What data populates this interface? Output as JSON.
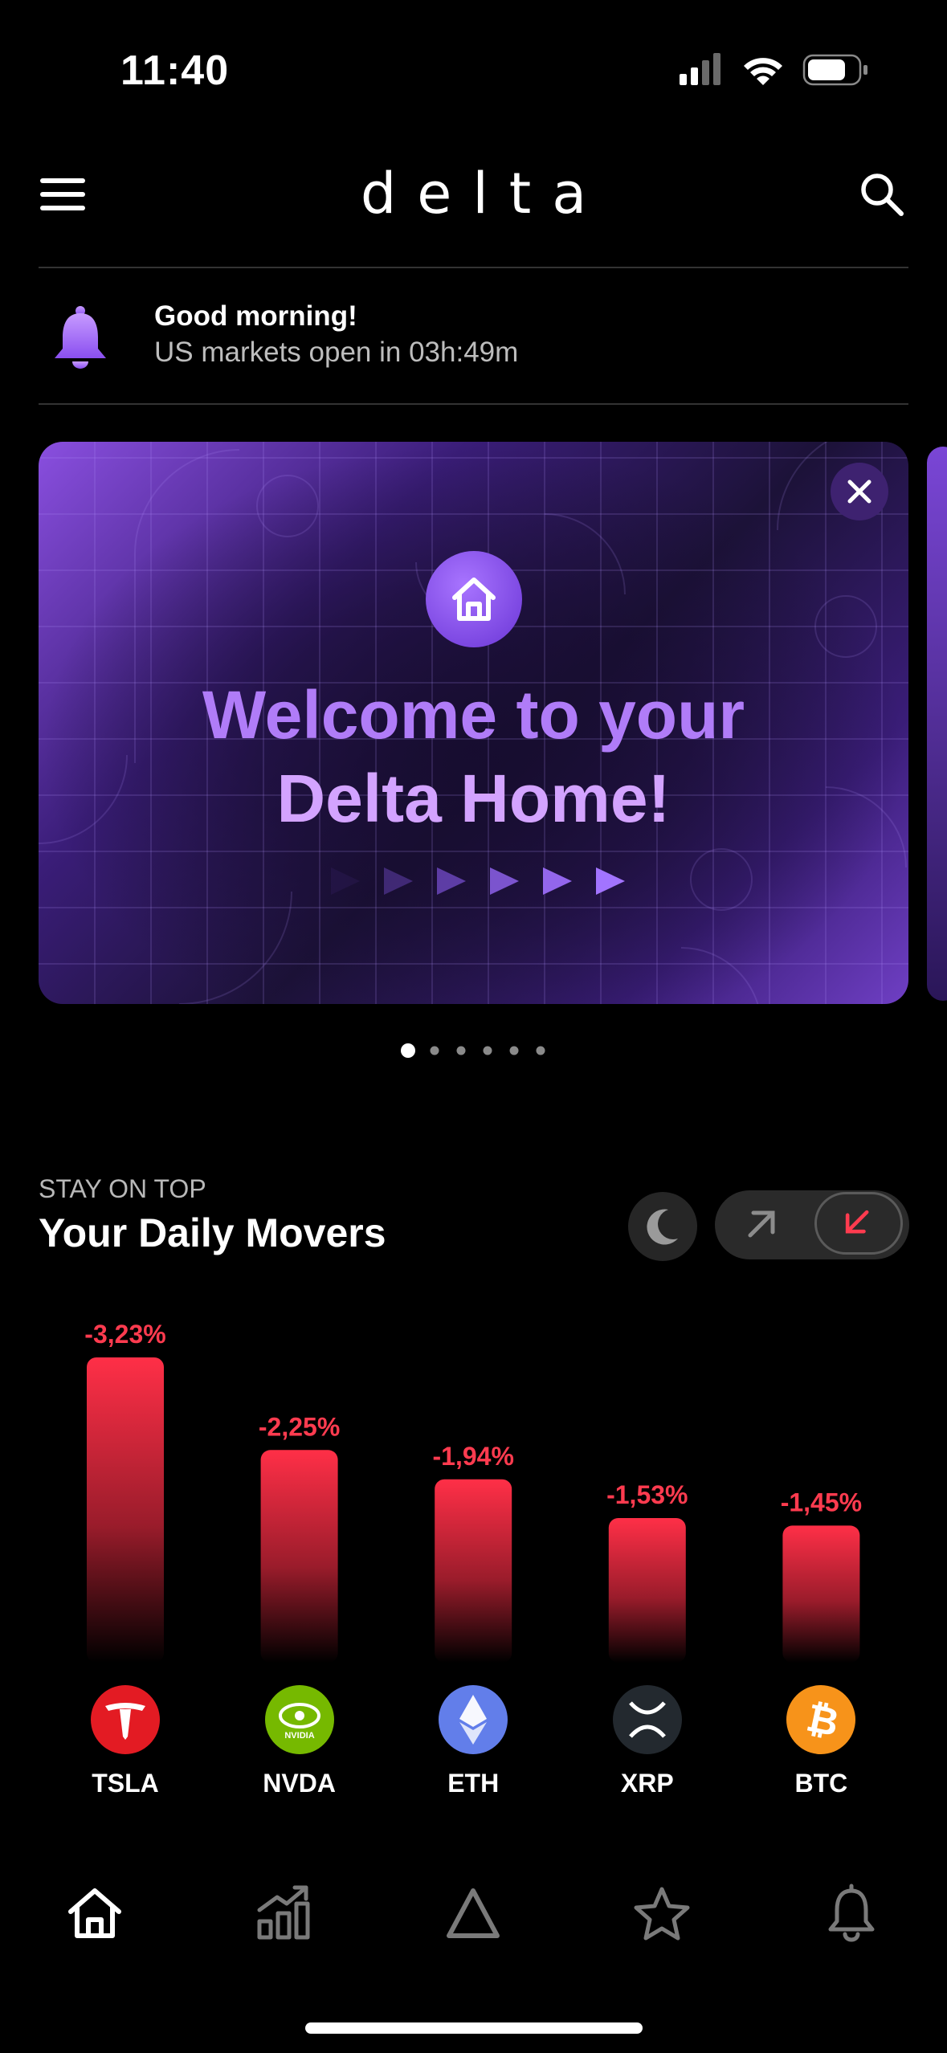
{
  "status_bar": {
    "time": "11:40"
  },
  "header": {
    "logo": "delta",
    "menu_icon": "hamburger-icon",
    "search_icon": "search-icon"
  },
  "greeting": {
    "title": "Good morning!",
    "subtitle": "US markets open in 03h:49m",
    "icon": "bell-icon"
  },
  "banner": {
    "line1": "Welcome to your",
    "line2": "Delta Home!",
    "icon": "home-icon",
    "close_icon": "close-icon"
  },
  "carousel": {
    "page_count": 6,
    "active_index": 0
  },
  "movers": {
    "kicker": "STAY ON TOP",
    "title": "Your Daily Movers",
    "mode": "losers",
    "items": [
      {
        "ticker": "TSLA",
        "change_label": "-3,23%",
        "change": -3.23,
        "logo_color": "#e31b23"
      },
      {
        "ticker": "NVDA",
        "change_label": "-2,25%",
        "change": -2.25,
        "logo_color": "#76b900"
      },
      {
        "ticker": "ETH",
        "change_label": "-1,94%",
        "change": -1.94,
        "logo_color": "#627eea"
      },
      {
        "ticker": "XRP",
        "change_label": "-1,53%",
        "change": -1.53,
        "logo_color": "#23292f"
      },
      {
        "ticker": "BTC",
        "change_label": "-1,45%",
        "change": -1.45,
        "logo_color": "#f7931a"
      }
    ]
  },
  "colors": {
    "negative": "#ff3b4f",
    "accent": "#9b6cf2",
    "background": "#000000"
  },
  "tab_bar": {
    "tabs": [
      {
        "icon": "home-icon",
        "active": true
      },
      {
        "icon": "chart-icon",
        "active": false
      },
      {
        "icon": "delta-icon",
        "active": false
      },
      {
        "icon": "star-icon",
        "active": false
      },
      {
        "icon": "bell-icon",
        "active": false
      }
    ]
  }
}
